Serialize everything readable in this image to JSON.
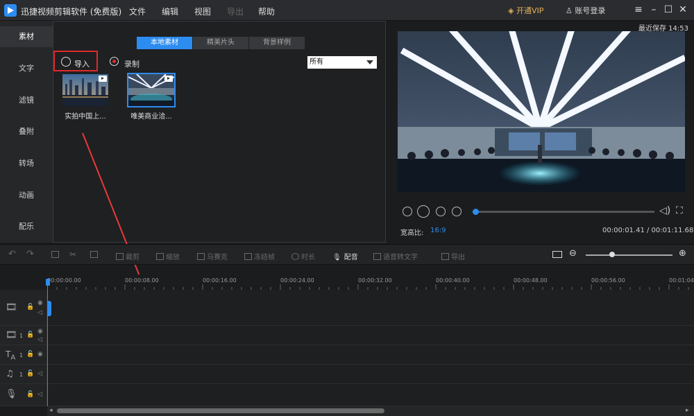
{
  "titlebar": {
    "app_title": "迅捷视频剪辑软件 (免费版)",
    "menu": [
      "文件",
      "编辑",
      "视图",
      "导出",
      "帮助"
    ],
    "vip": "开通VIP",
    "login": "账号登录"
  },
  "left_tabs": [
    "素材",
    "文字",
    "滤镜",
    "叠附",
    "转场",
    "动画",
    "配乐"
  ],
  "media": {
    "tabs": [
      "本地素材",
      "精美片头",
      "背景样例"
    ],
    "import_label": "导入",
    "record_label": "录制",
    "filter_value": "所有",
    "items": [
      "实拍中国上...",
      "唯美商业洽..."
    ]
  },
  "preview": {
    "last_saved": "最近保存 14:53",
    "ratio_label": "宽高比:",
    "ratio_value": "16:9",
    "time": "00:00:01.41 / 00:01:11.68",
    "progress": 0.01
  },
  "toolbar": {
    "tools": [
      "裁剪",
      "缩放",
      "马赛克",
      "冻结帧",
      "时长",
      "配音",
      "语音转文字",
      "导出"
    ]
  },
  "timeline": {
    "ticks": [
      "00:00:00.00",
      "00:00:08.00",
      "00:00:16.00",
      "00:00:24.00",
      "00:00:32.00",
      "00:00:40.00",
      "00:00:48.00",
      "00:00:56.00",
      "00:01:04"
    ],
    "track_numbers": [
      "1",
      "1",
      "1"
    ]
  },
  "colors": {
    "accent": "#2d8cf0",
    "highlight_box": "#e02a2a",
    "vip": "#e3b25b"
  }
}
